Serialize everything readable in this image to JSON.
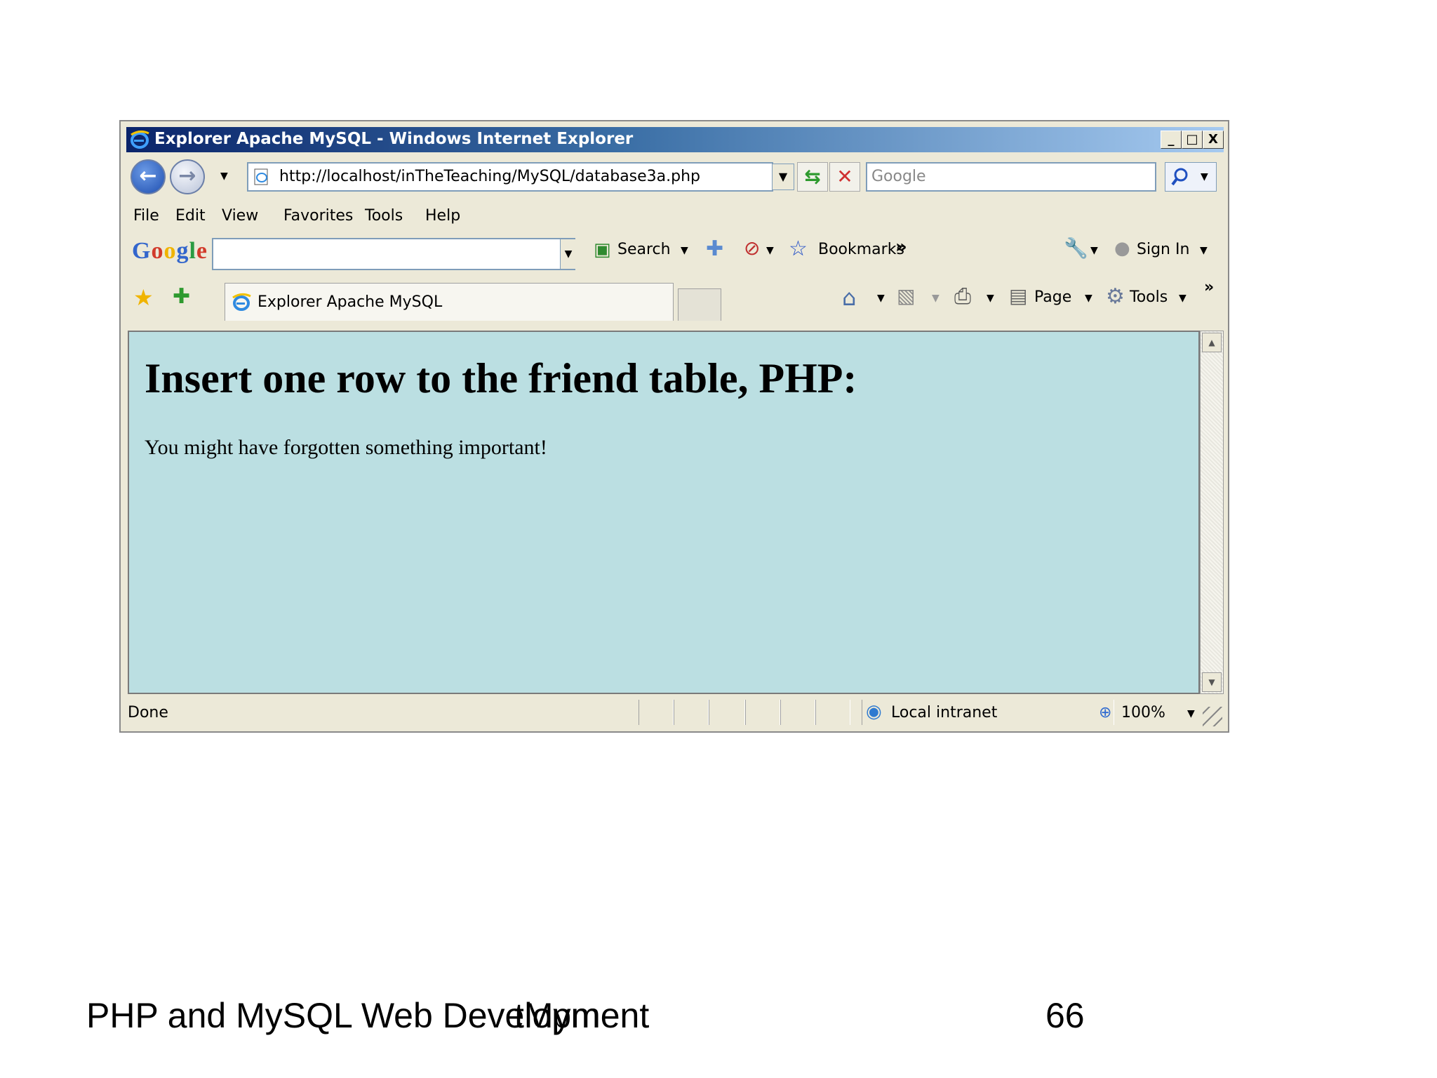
{
  "window": {
    "title": "Explorer Apache MySQL - Windows Internet Explorer",
    "controls": {
      "minimize": "_",
      "maximize": "□",
      "close": "X"
    }
  },
  "address_bar": {
    "url": "http://localhost/inTheTeaching/MySQL/database3a.php",
    "search_placeholder": "Google"
  },
  "menu": [
    "File",
    "Edit",
    "View",
    "Favorites",
    "Tools",
    "Help"
  ],
  "google_toolbar": {
    "logo": "Google",
    "search_label": "Search",
    "bookmarks_label": "Bookmarks",
    "overflow": "»",
    "sign_in_label": "Sign In"
  },
  "tabs": {
    "active_label": "Explorer Apache MySQL",
    "page_label": "Page",
    "tools_label": "Tools",
    "overflow": "»"
  },
  "page": {
    "heading": "Insert one row to the friend table, PHP:",
    "message": "You might have forgotten something important!"
  },
  "status": {
    "text": "Done",
    "zone": "Local intranet",
    "zoom": "100%"
  },
  "slide": {
    "footer": "PHP and MySQL Web Development",
    "overlap": "tMym",
    "number": "66"
  },
  "colors": {
    "page_background": "#bbdfe2",
    "chrome": "#ece9d8",
    "titlebar_start": "#0a246a",
    "titlebar_end": "#a6caf0"
  }
}
